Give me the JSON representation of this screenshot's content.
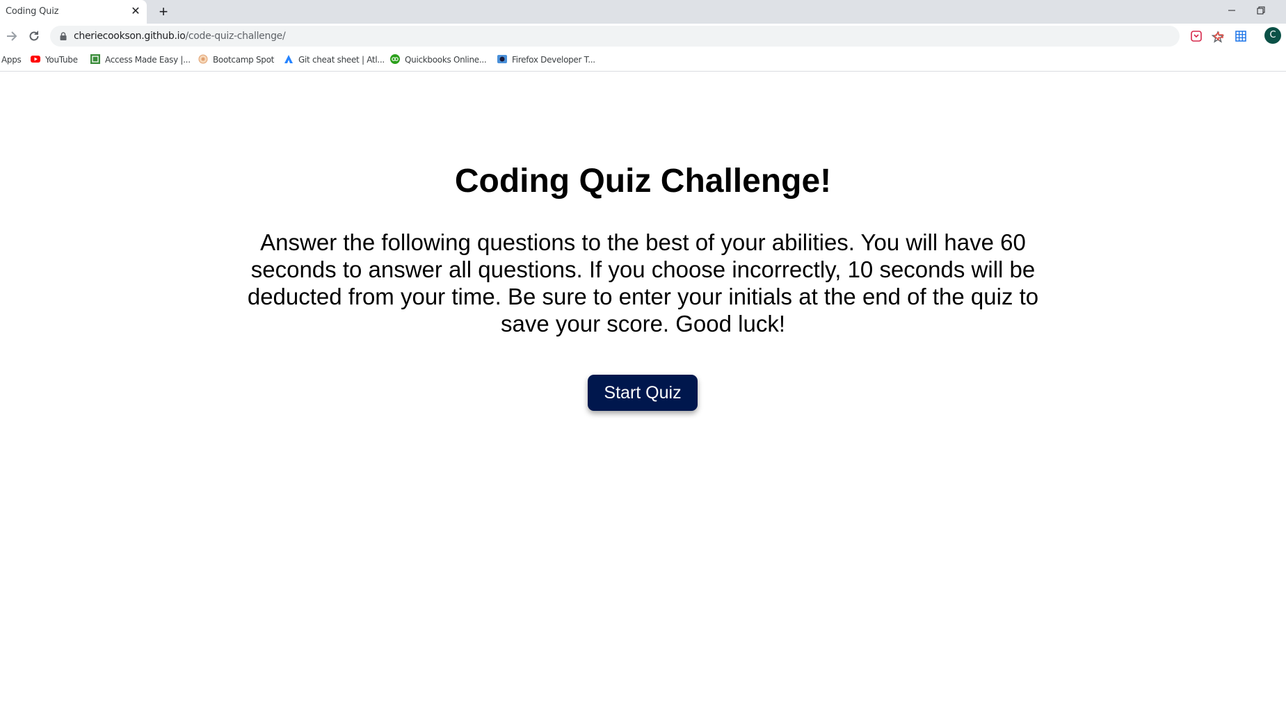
{
  "tab": {
    "title": "Coding Quiz"
  },
  "address_bar": {
    "host": "cheriecookson.github.io",
    "path": "/code-quiz-challenge/"
  },
  "profile": {
    "initial": "C",
    "color": "#0b5147"
  },
  "bookmarks": [
    {
      "label": "Apps",
      "icon": "apps-icon"
    },
    {
      "label": "YouTube",
      "icon": "youtube-icon"
    },
    {
      "label": "Access Made Easy |...",
      "icon": "access-made-easy-icon"
    },
    {
      "label": "Bootcamp Spot",
      "icon": "bootcamp-spot-icon"
    },
    {
      "label": "Git cheat sheet | Atl...",
      "icon": "atlassian-icon"
    },
    {
      "label": "Quickbooks Online...",
      "icon": "quickbooks-icon"
    },
    {
      "label": "Firefox Developer T...",
      "icon": "firefox-developer-icon"
    }
  ],
  "main": {
    "title": "Coding Quiz Challenge!",
    "intro": "Answer the following questions to the best of your abilities. You will have 60 seconds to answer all questions. If you choose incorrectly, 10 seconds will be deducted from your time. Be sure to enter your initials at the end of the quiz to save your score. Good luck!",
    "start_label": "Start Quiz"
  },
  "colors": {
    "button_bg": "#00174d",
    "button_text": "#ffffff"
  }
}
